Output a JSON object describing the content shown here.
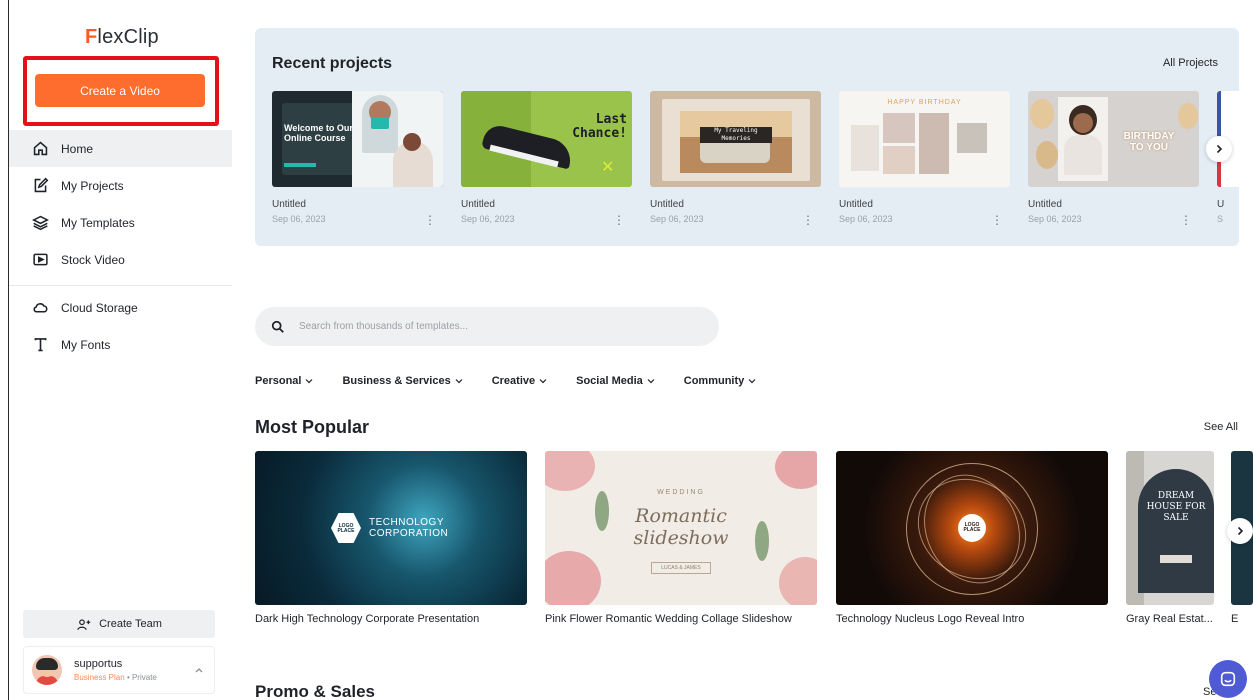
{
  "sidebar": {
    "logo": {
      "first": "F",
      "rest": "lexClip"
    },
    "create_button": "Create a Video",
    "nav": [
      {
        "label": "Home",
        "icon": "home-icon"
      },
      {
        "label": "My Projects",
        "icon": "edit-icon"
      },
      {
        "label": "My Templates",
        "icon": "layers-icon"
      },
      {
        "label": "Stock Video",
        "icon": "video-icon"
      }
    ],
    "nav2": [
      {
        "label": "Cloud Storage",
        "icon": "cloud-icon"
      },
      {
        "label": "My Fonts",
        "icon": "font-icon"
      }
    ],
    "create_team": "Create Team",
    "user": {
      "name": "supportus",
      "plan": "Business Plan",
      "visibility": "• Private"
    }
  },
  "recent": {
    "title": "Recent projects",
    "all_link": "All Projects",
    "projects": [
      {
        "name": "Untitled",
        "date": "Sep 06, 2023",
        "thumb_text": "Welcome to Our Online Course"
      },
      {
        "name": "Untitled",
        "date": "Sep 06, 2023",
        "thumb_text": "Last Chance!"
      },
      {
        "name": "Untitled",
        "date": "Sep 06, 2023",
        "thumb_text": "My Traveling Memories"
      },
      {
        "name": "Untitled",
        "date": "Sep 06, 2023",
        "thumb_text": "HAPPY BIRTHDAY"
      },
      {
        "name": "Untitled",
        "date": "Sep 06, 2023",
        "thumb_text": "BIRTHDAY TO YOU"
      },
      {
        "name": "U",
        "date": "S"
      }
    ]
  },
  "search": {
    "placeholder": "Search from thousands of templates..."
  },
  "categories": [
    "Personal",
    "Business & Services",
    "Creative",
    "Social Media",
    "Community"
  ],
  "popular": {
    "title": "Most Popular",
    "see_all": "See All",
    "templates": [
      {
        "name": "Dark High Technology Corporate Presentation",
        "thumb_text": "TECHNOLOGY CORPORATION",
        "logo": "LOGO PLACE"
      },
      {
        "name": "Pink Flower Romantic Wedding Collage Slideshow",
        "thumb_kicker": "WEDDING",
        "thumb_text": "Romantic slideshow",
        "thumb_sub": "LUCAS & JAMES"
      },
      {
        "name": "Technology Nucleus Logo Reveal Intro",
        "logo": "LOGO PLACE"
      },
      {
        "name": "Gray Real Estat...",
        "thumb_text": "DREAM HOUSE FOR SALE"
      },
      {
        "name": "E"
      }
    ]
  },
  "promo": {
    "title": "Promo & Sales",
    "see_all": "See"
  }
}
